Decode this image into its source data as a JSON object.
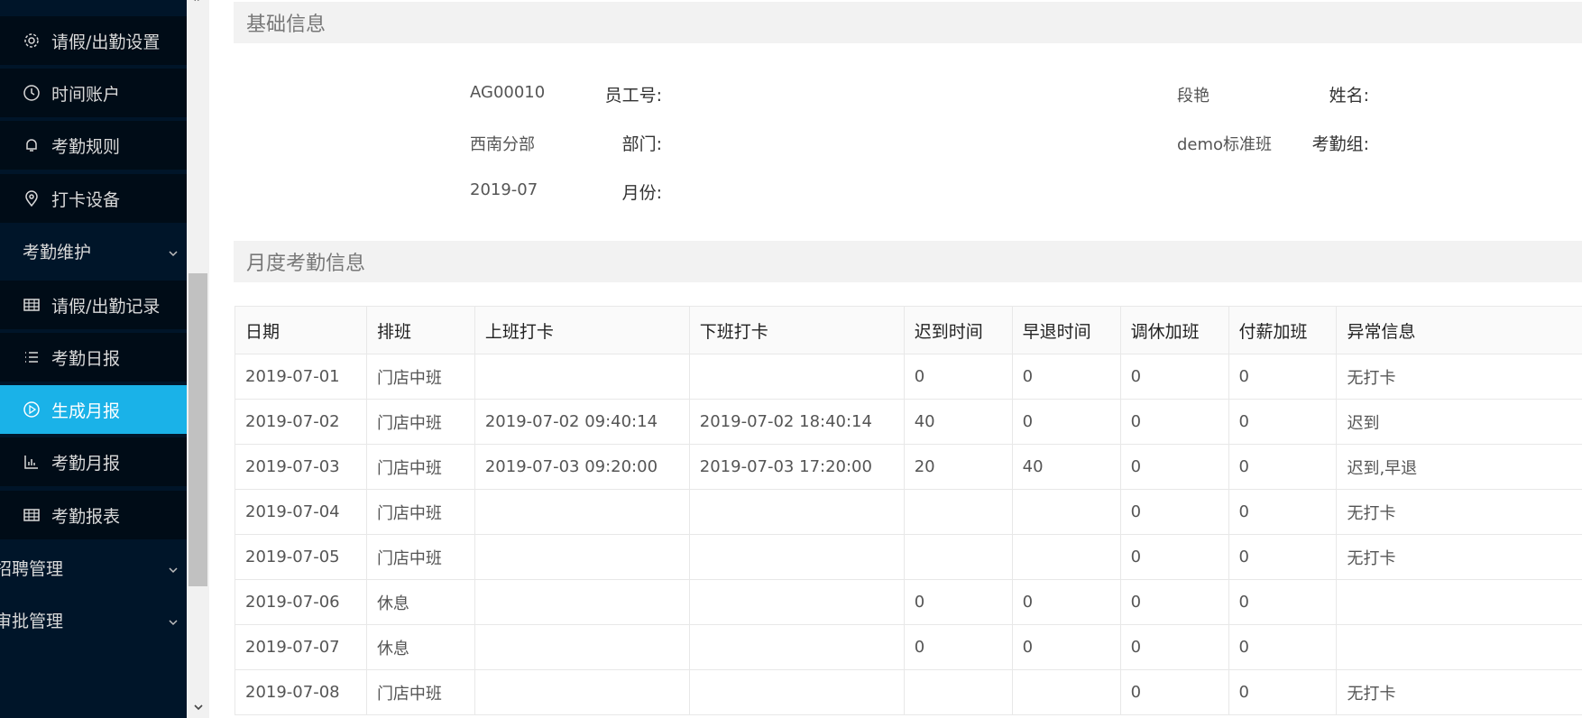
{
  "sidebar": {
    "items": [
      {
        "label": "请假/出勤设置",
        "icon": "gear-icon",
        "kind": "sub"
      },
      {
        "label": "时间账户",
        "icon": "clock-icon",
        "kind": "sub"
      },
      {
        "label": "考勤规则",
        "icon": "bell-icon",
        "kind": "sub"
      },
      {
        "label": "打卡设备",
        "icon": "location-pin-icon",
        "kind": "sub"
      },
      {
        "label": "考勤维护",
        "icon": "",
        "kind": "group"
      },
      {
        "label": "请假/出勤记录",
        "icon": "table-icon",
        "kind": "sub"
      },
      {
        "label": "考勤日报",
        "icon": "list-icon",
        "kind": "sub"
      },
      {
        "label": "生成月报",
        "icon": "play-circle-icon",
        "kind": "sub",
        "active": true
      },
      {
        "label": "考勤月报",
        "icon": "bar-chart-icon",
        "kind": "sub"
      },
      {
        "label": "考勤报表",
        "icon": "table-icon",
        "kind": "sub"
      },
      {
        "label": "招聘管理",
        "icon": "",
        "kind": "top"
      },
      {
        "label": "审批管理",
        "icon": "",
        "kind": "top"
      }
    ],
    "active_color": "#1ab2e8",
    "bg_color": "#001529"
  },
  "basic_info": {
    "title": "基础信息",
    "employee_no_label": "员工号:",
    "employee_no": "AG00010",
    "name_label": "姓名:",
    "name": "段艳",
    "dept_label": "部门:",
    "dept": "西南分部",
    "group_label": "考勤组:",
    "group": "demo标准班",
    "month_label": "月份:",
    "month": "2019-07"
  },
  "monthly": {
    "title": "月度考勤信息",
    "columns": [
      "日期",
      "排班",
      "上班打卡",
      "下班打卡",
      "迟到时间",
      "早退时间",
      "调休加班",
      "付薪加班",
      "异常信息"
    ],
    "rows": [
      [
        "2019-07-01",
        "门店中班",
        "",
        "",
        "0",
        "0",
        "0",
        "0",
        "无打卡"
      ],
      [
        "2019-07-02",
        "门店中班",
        "2019-07-02 09:40:14",
        "2019-07-02 18:40:14",
        "40",
        "0",
        "0",
        "0",
        "迟到"
      ],
      [
        "2019-07-03",
        "门店中班",
        "2019-07-03 09:20:00",
        "2019-07-03 17:20:00",
        "20",
        "40",
        "0",
        "0",
        "迟到,早退"
      ],
      [
        "2019-07-04",
        "门店中班",
        "",
        "",
        "",
        "",
        "0",
        "0",
        "无打卡"
      ],
      [
        "2019-07-05",
        "门店中班",
        "",
        "",
        "",
        "",
        "0",
        "0",
        "无打卡"
      ],
      [
        "2019-07-06",
        "休息",
        "",
        "",
        "0",
        "0",
        "0",
        "0",
        ""
      ],
      [
        "2019-07-07",
        "休息",
        "",
        "",
        "0",
        "0",
        "0",
        "0",
        ""
      ],
      [
        "2019-07-08",
        "门店中班",
        "",
        "",
        "",
        "",
        "0",
        "0",
        "无打卡"
      ]
    ]
  }
}
